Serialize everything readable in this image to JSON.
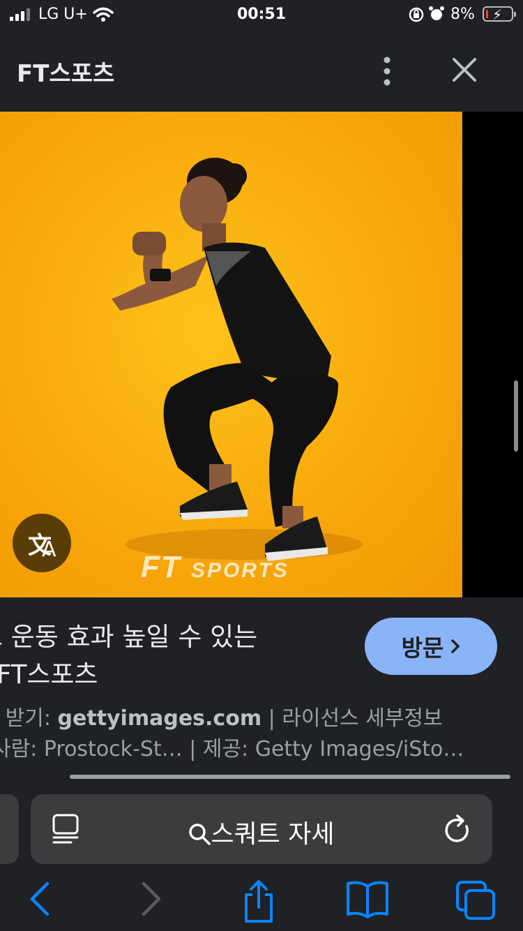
{
  "status_bar": {
    "carrier": "LG U+",
    "time": "00:51",
    "battery_percent": "8%",
    "battery_level": 0.08
  },
  "header": {
    "title": "FT스포츠"
  },
  "image": {
    "watermark_main": "FT",
    "watermark_sub": "SPORTS"
  },
  "translate_button": {
    "glyph_1": "文",
    "glyph_2": "A"
  },
  "result": {
    "title_line_1": "트 운동 효과 높일 수 있는",
    "title_line_2": "- FT스포츠",
    "visit_label": "방문",
    "source_prefix": "| 받기: ",
    "source_domain": "gettyimages.com",
    "license_text": " | 라이선스 세부정보",
    "creator_text": "사람: Prostock-St…  | 제공: Getty Images/iSto…"
  },
  "address_bar": {
    "query": "스쿼트 자세"
  },
  "colors": {
    "background": "#202124",
    "visit_button": "#8ab4f8",
    "toolbar_icon": "#0a84ff",
    "image_background": "#f7a70a"
  }
}
